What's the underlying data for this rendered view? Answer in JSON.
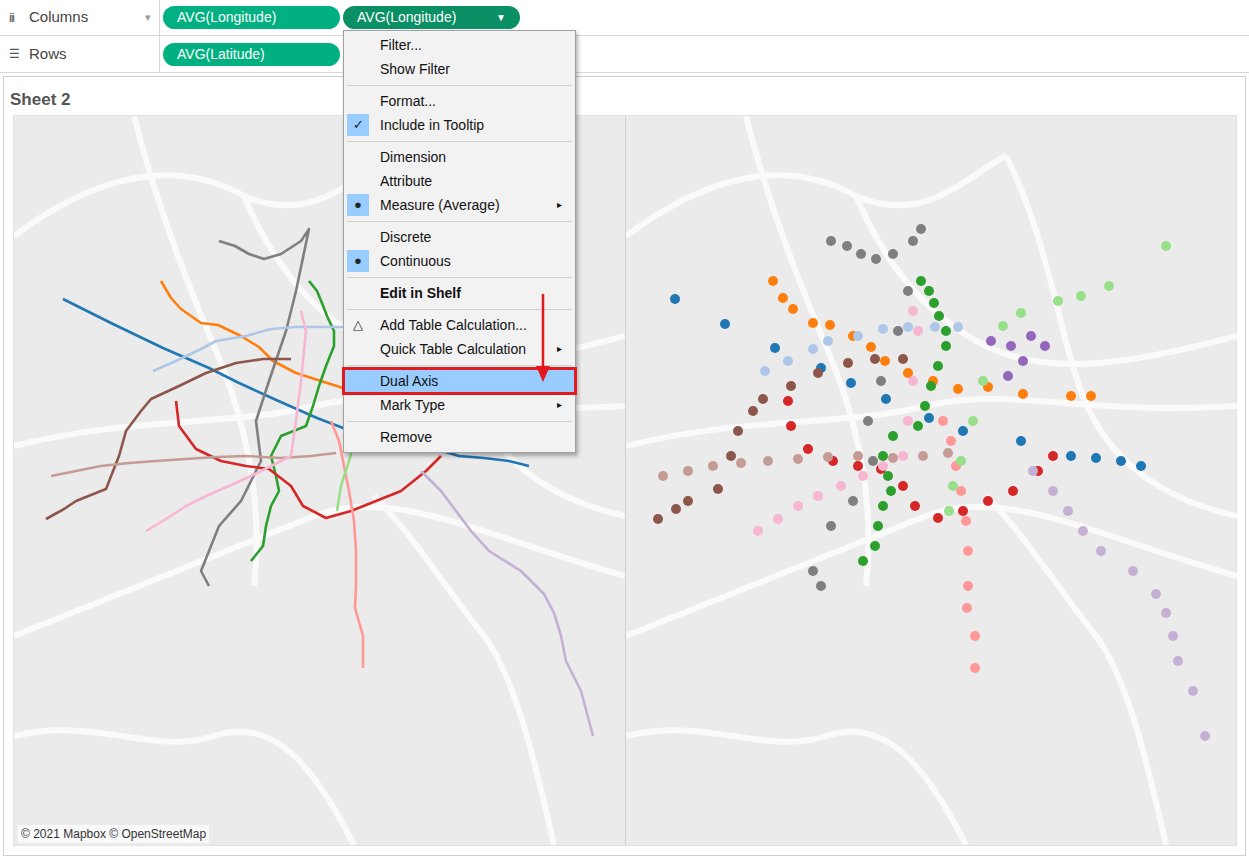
{
  "shelves": [
    {
      "icon": "iii",
      "label": "Columns",
      "caret": "▾",
      "pills": [
        {
          "text": "AVG(Longitude)",
          "selected": false,
          "arrow": ""
        },
        {
          "text": "AVG(Longitude)",
          "selected": true,
          "arrow": "▼"
        }
      ]
    },
    {
      "icon": "☰",
      "label": "Rows",
      "caret": "",
      "pills": [
        {
          "text": "AVG(Latitude)",
          "selected": false,
          "arrow": ""
        }
      ]
    }
  ],
  "sheet": {
    "title": "Sheet 2",
    "attribution": "© 2021 Mapbox © OpenStreetMap"
  },
  "panes": [
    {
      "kind": "line"
    },
    {
      "kind": "circle"
    }
  ],
  "map": {
    "series": [
      {
        "color": "#1f77b4",
        "stations": [
          [
            49,
            183
          ],
          [
            99,
            208
          ],
          [
            149,
            232
          ],
          [
            195,
            252
          ],
          [
            225,
            267
          ],
          [
            260,
            283
          ],
          [
            303,
            302
          ],
          [
            337,
            315
          ],
          [
            395,
            325
          ],
          [
            445,
            340
          ],
          [
            470,
            342
          ],
          [
            495,
            345
          ],
          [
            515,
            350
          ]
        ]
      },
      {
        "color": "#ff7f0e",
        "stations": [
          [
            147,
            165
          ],
          [
            157,
            182
          ],
          [
            167,
            193
          ],
          [
            187,
            207
          ],
          [
            204,
            209
          ],
          [
            227,
            220
          ],
          [
            245,
            231
          ],
          [
            259,
            245
          ],
          [
            282,
            257
          ],
          [
            307,
            265
          ],
          [
            332,
            273
          ],
          [
            362,
            271
          ],
          [
            397,
            278
          ],
          [
            445,
            280
          ],
          [
            465,
            280
          ]
        ]
      },
      {
        "color": "#2ca02c",
        "stations": [
          [
            295,
            165
          ],
          [
            303,
            175
          ],
          [
            308,
            187
          ],
          [
            313,
            200
          ],
          [
            320,
            215
          ],
          [
            320,
            230
          ],
          [
            312,
            250
          ],
          [
            305,
            270
          ],
          [
            299,
            290
          ],
          [
            292,
            310
          ],
          [
            267,
            320
          ],
          [
            257,
            340
          ],
          [
            262,
            360
          ],
          [
            265,
            375
          ],
          [
            257,
            390
          ],
          [
            252,
            410
          ],
          [
            249,
            430
          ],
          [
            237,
            445
          ]
        ]
      },
      {
        "color": "#7f7f7f",
        "stations": [
          [
            205,
            125
          ],
          [
            221,
            130
          ],
          [
            235,
            138
          ],
          [
            250,
            143
          ],
          [
            267,
            138
          ],
          [
            287,
            125
          ],
          [
            295,
            113
          ],
          [
            282,
            175
          ],
          [
            272,
            215
          ],
          [
            255,
            265
          ],
          [
            242,
            305
          ],
          [
            247,
            345
          ],
          [
            227,
            385
          ],
          [
            205,
            410
          ],
          [
            187,
            455
          ],
          [
            195,
            470
          ]
        ]
      },
      {
        "color": "#d62728",
        "stations": [
          [
            162,
            285
          ],
          [
            165,
            310
          ],
          [
            182,
            333
          ],
          [
            207,
            345
          ],
          [
            232,
            350
          ],
          [
            255,
            353
          ],
          [
            277,
            370
          ],
          [
            289,
            390
          ],
          [
            312,
            402
          ],
          [
            337,
            395
          ],
          [
            362,
            385
          ],
          [
            387,
            375
          ],
          [
            412,
            355
          ],
          [
            427,
            340
          ]
        ]
      },
      {
        "color": "#8c564b",
        "stations": [
          [
            32,
            403
          ],
          [
            50,
            393
          ],
          [
            62,
            385
          ],
          [
            92,
            373
          ],
          [
            105,
            340
          ],
          [
            112,
            315
          ],
          [
            127,
            295
          ],
          [
            137,
            283
          ],
          [
            165,
            270
          ],
          [
            192,
            257
          ],
          [
            222,
            247
          ],
          [
            249,
            243
          ],
          [
            277,
            243
          ]
        ]
      },
      {
        "color": "#c49c94",
        "stations": [
          [
            37,
            360
          ],
          [
            62,
            355
          ],
          [
            87,
            350
          ],
          [
            115,
            347
          ],
          [
            142,
            345
          ],
          [
            172,
            343
          ],
          [
            202,
            341
          ],
          [
            232,
            340
          ],
          [
            267,
            342
          ],
          [
            297,
            340
          ],
          [
            322,
            337
          ]
        ]
      },
      {
        "color": "#aec7e8",
        "stations": [
          [
            139,
            255
          ],
          [
            162,
            245
          ],
          [
            187,
            233
          ],
          [
            202,
            225
          ],
          [
            232,
            220
          ],
          [
            257,
            213
          ],
          [
            282,
            211
          ],
          [
            309,
            211
          ],
          [
            332,
            211
          ]
        ]
      },
      {
        "color": "#f7b6d2",
        "stations": [
          [
            132,
            415
          ],
          [
            152,
            403
          ],
          [
            172,
            390
          ],
          [
            192,
            380
          ],
          [
            215,
            370
          ],
          [
            237,
            360
          ],
          [
            257,
            350
          ],
          [
            277,
            340
          ],
          [
            282,
            305
          ],
          [
            287,
            265
          ],
          [
            292,
            215
          ],
          [
            287,
            195
          ]
        ]
      },
      {
        "color": "#ff9896",
        "stations": [
          [
            317,
            305
          ],
          [
            325,
            325
          ],
          [
            330,
            350
          ],
          [
            335,
            375
          ],
          [
            340,
            405
          ],
          [
            342,
            435
          ],
          [
            342,
            470
          ],
          [
            341,
            492
          ],
          [
            349,
            520
          ],
          [
            349,
            552
          ]
        ]
      },
      {
        "color": "#c5b0d5",
        "stations": [
          [
            407,
            355
          ],
          [
            427,
            375
          ],
          [
            442,
            395
          ],
          [
            457,
            415
          ],
          [
            475,
            435
          ],
          [
            507,
            455
          ],
          [
            530,
            478
          ],
          [
            540,
            497
          ],
          [
            547,
            520
          ],
          [
            552,
            545
          ],
          [
            567,
            575
          ],
          [
            579,
            620
          ]
        ]
      },
      {
        "color": "#9467bd",
        "stations": [
          [
            365,
            225
          ],
          [
            385,
            230
          ],
          [
            405,
            220
          ],
          [
            419,
            230
          ],
          [
            397,
            245
          ],
          [
            382,
            260
          ]
        ]
      },
      {
        "color": "#98df8a",
        "stations": [
          [
            540,
            130
          ],
          [
            483,
            170
          ],
          [
            455,
            180
          ],
          [
            432,
            185
          ],
          [
            395,
            197
          ],
          [
            377,
            210
          ],
          [
            357,
            265
          ],
          [
            347,
            305
          ],
          [
            335,
            345
          ],
          [
            327,
            370
          ],
          [
            323,
            395
          ]
        ]
      }
    ]
  },
  "menu": {
    "items": [
      {
        "kind": "item",
        "label": "Filter...",
        "glyph": "",
        "checked": false,
        "bold": false,
        "submenu": "",
        "selected": false
      },
      {
        "kind": "item",
        "label": "Show Filter",
        "glyph": "",
        "checked": false,
        "bold": false,
        "submenu": "",
        "selected": false
      },
      {
        "kind": "separator"
      },
      {
        "kind": "item",
        "label": "Format...",
        "glyph": "",
        "checked": false,
        "bold": false,
        "submenu": "",
        "selected": false
      },
      {
        "kind": "item",
        "label": "Include in Tooltip",
        "glyph": "✓",
        "checked": true,
        "bold": false,
        "submenu": "",
        "selected": false
      },
      {
        "kind": "separator"
      },
      {
        "kind": "item",
        "label": "Dimension",
        "glyph": "",
        "checked": false,
        "bold": false,
        "submenu": "",
        "selected": false
      },
      {
        "kind": "item",
        "label": "Attribute",
        "glyph": "",
        "checked": false,
        "bold": false,
        "submenu": "",
        "selected": false
      },
      {
        "kind": "item",
        "label": "Measure (Average)",
        "glyph": "●",
        "checked": true,
        "bold": false,
        "submenu": "▸",
        "selected": false
      },
      {
        "kind": "separator"
      },
      {
        "kind": "item",
        "label": "Discrete",
        "glyph": "",
        "checked": false,
        "bold": false,
        "submenu": "",
        "selected": false
      },
      {
        "kind": "item",
        "label": "Continuous",
        "glyph": "●",
        "checked": true,
        "bold": false,
        "submenu": "",
        "selected": false
      },
      {
        "kind": "separator"
      },
      {
        "kind": "item",
        "label": "Edit in Shelf",
        "glyph": "",
        "checked": false,
        "bold": true,
        "submenu": "",
        "selected": false
      },
      {
        "kind": "separator"
      },
      {
        "kind": "item",
        "label": "Add Table Calculation...",
        "glyph": "△",
        "checked": false,
        "bold": false,
        "submenu": "",
        "selected": false
      },
      {
        "kind": "item",
        "label": "Quick Table Calculation",
        "glyph": "",
        "checked": false,
        "bold": false,
        "submenu": "▸",
        "selected": false
      },
      {
        "kind": "separator"
      },
      {
        "kind": "item",
        "label": "Dual Axis",
        "glyph": "",
        "checked": false,
        "bold": false,
        "submenu": "",
        "selected": true
      },
      {
        "kind": "item",
        "label": "Mark Type",
        "glyph": "",
        "checked": false,
        "bold": false,
        "submenu": "▸",
        "selected": false
      },
      {
        "kind": "separator"
      },
      {
        "kind": "item",
        "label": "Remove",
        "glyph": "",
        "checked": false,
        "bold": false,
        "submenu": "",
        "selected": false
      }
    ]
  }
}
